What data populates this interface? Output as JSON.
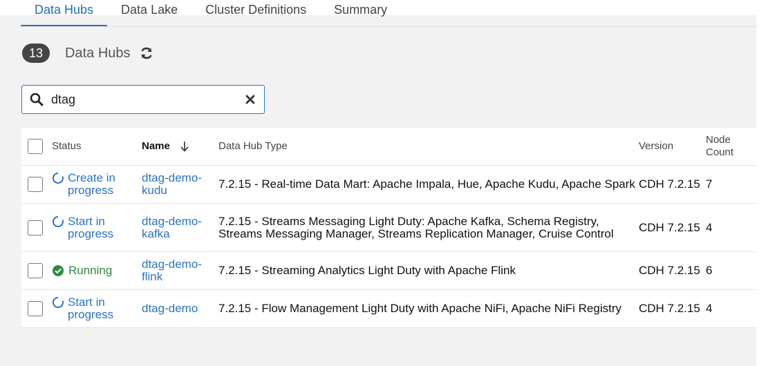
{
  "tabs": [
    {
      "label": "Data Hubs",
      "active": true
    },
    {
      "label": "Data Lake",
      "active": false
    },
    {
      "label": "Cluster Definitions",
      "active": false
    },
    {
      "label": "Summary",
      "active": false
    }
  ],
  "header": {
    "count": "13",
    "label": "Data Hubs"
  },
  "search": {
    "value": "dtag",
    "placeholder": ""
  },
  "table": {
    "columns": {
      "status": "Status",
      "name": "Name",
      "type": "Data Hub Type",
      "version": "Version",
      "node_count": "Node Count"
    },
    "rows": [
      {
        "status": "Create in progress",
        "status_kind": "in-progress",
        "name": "dtag-demo-kudu",
        "type": "7.2.15 - Real-time Data Mart: Apache Impala, Hue, Apache Kudu, Apache Spark",
        "version": "CDH 7.2.15",
        "node_count": "7"
      },
      {
        "status": "Start in progress",
        "status_kind": "in-progress",
        "name": "dtag-demo-kafka",
        "type": "7.2.15 - Streams Messaging Light Duty: Apache Kafka, Schema Registry, Streams Messaging Manager, Streams Replication Manager, Cruise Control",
        "version": "CDH 7.2.15",
        "node_count": "4"
      },
      {
        "status": "Running",
        "status_kind": "running",
        "name": "dtag-demo-flink",
        "type": "7.2.15 - Streaming Analytics Light Duty with Apache Flink",
        "version": "CDH 7.2.15",
        "node_count": "6"
      },
      {
        "status": "Start in progress",
        "status_kind": "in-progress",
        "name": "dtag-demo",
        "type": "7.2.15 - Flow Management Light Duty with Apache NiFi, Apache NiFi Registry",
        "version": "CDH 7.2.15",
        "node_count": "4"
      }
    ]
  },
  "colors": {
    "accent": "#2a74c4",
    "running": "#2e8b3e",
    "badge": "#444444",
    "panel": "#f2f2f2"
  }
}
